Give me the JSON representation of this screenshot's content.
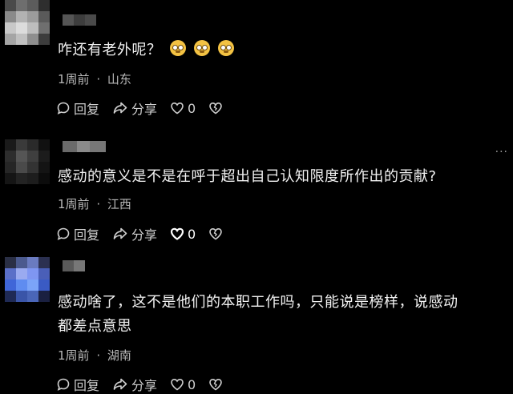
{
  "comments": [
    {
      "text": "咋还有老外呢？",
      "emoji_count": 3,
      "time": "1周前",
      "separator": "·",
      "location": "山东",
      "reply_label": "回复",
      "share_label": "分享",
      "like_count": "0",
      "like_active": false
    },
    {
      "text": "感动的意义是不是在呼于超出自己认知限度所作出的贡献?",
      "time": "1周前",
      "separator": "·",
      "location": "江西",
      "reply_label": "回复",
      "share_label": "分享",
      "like_count": "0",
      "like_active": true,
      "more_label": "···"
    },
    {
      "text": "感动啥了，这不是他们的本职工作吗，只能说是榜样，说感动\n都差点意思",
      "time": "1周前",
      "separator": "·",
      "location": "湖南",
      "reply_label": "回复",
      "share_label": "分享",
      "like_count": "0",
      "like_active": false
    }
  ],
  "icons": {
    "reply": "reply-bubble-icon",
    "share": "share-arrow-icon",
    "like": "heart-icon",
    "dislike": "broken-heart-icon",
    "emoji": "flushed-face-emoji"
  },
  "colors": {
    "background": "#000000",
    "text": "#f2f2f2",
    "meta": "#b8b8b8",
    "emoji": "#f3c243"
  }
}
